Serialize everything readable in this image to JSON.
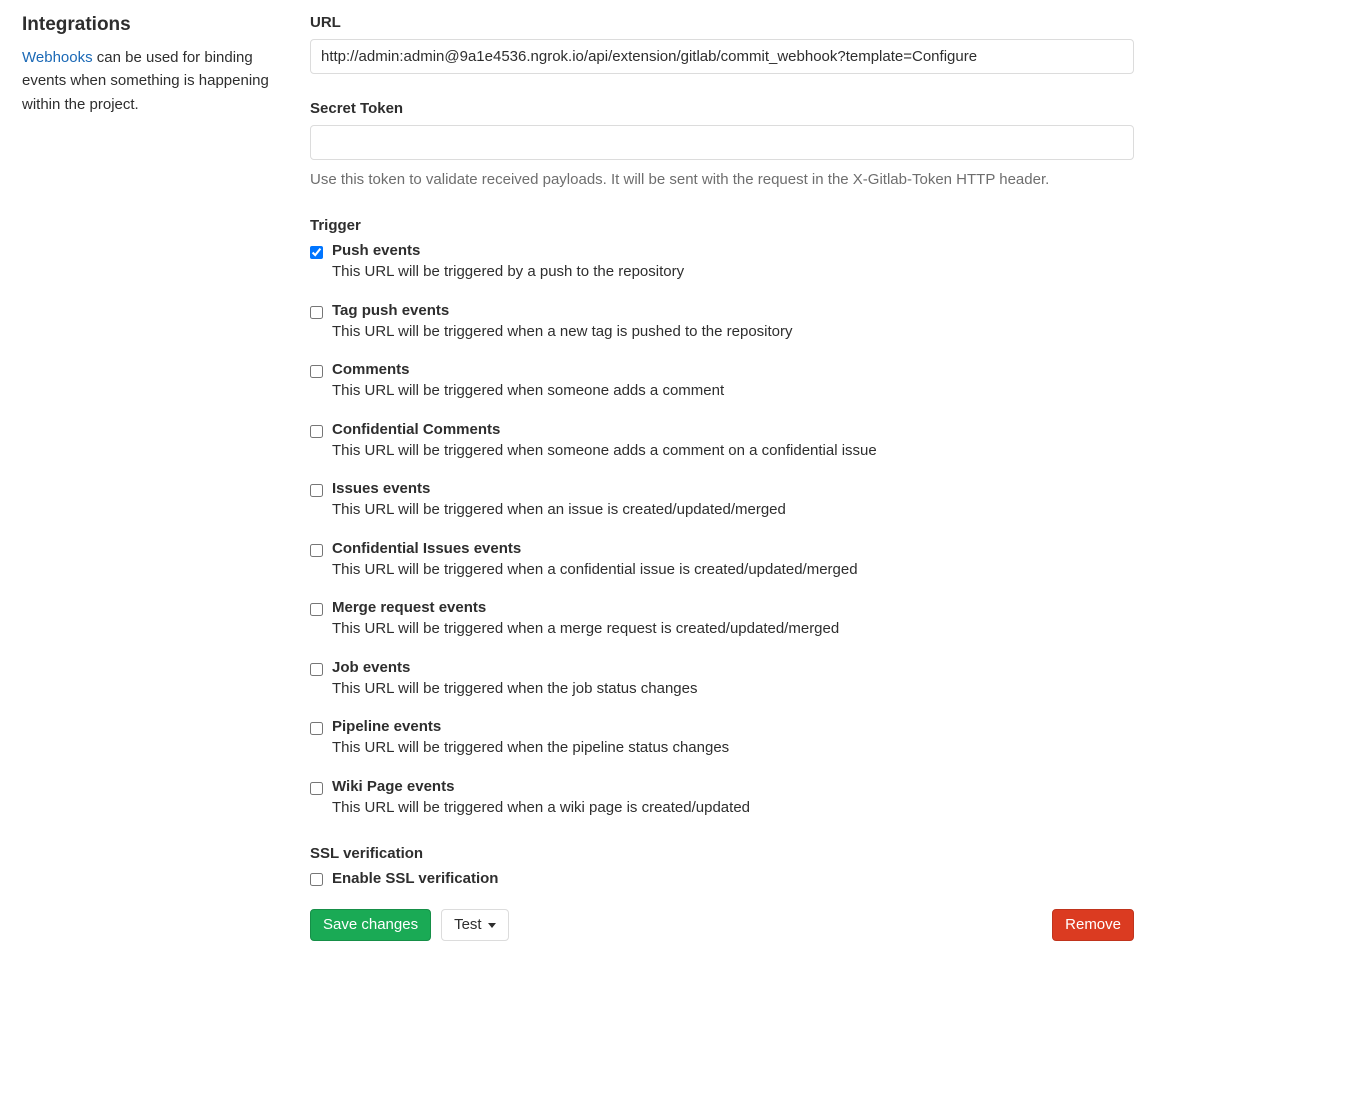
{
  "sidebar": {
    "heading": "Integrations",
    "link_text": "Webhooks",
    "desc_after_link": " can be used for binding events when something is happening within the project."
  },
  "url_field": {
    "label": "URL",
    "value": "http://admin:admin@9a1e4536.ngrok.io/api/extension/gitlab/commit_webhook?template=Configure"
  },
  "secret_field": {
    "label": "Secret Token",
    "value": "",
    "help": "Use this token to validate received payloads. It will be sent with the request in the X-Gitlab-Token HTTP header."
  },
  "trigger": {
    "heading": "Trigger",
    "items": [
      {
        "checked": true,
        "title": "Push events",
        "desc": "This URL will be triggered by a push to the repository"
      },
      {
        "checked": false,
        "title": "Tag push events",
        "desc": "This URL will be triggered when a new tag is pushed to the repository"
      },
      {
        "checked": false,
        "title": "Comments",
        "desc": "This URL will be triggered when someone adds a comment"
      },
      {
        "checked": false,
        "title": "Confidential Comments",
        "desc": "This URL will be triggered when someone adds a comment on a confidential issue"
      },
      {
        "checked": false,
        "title": "Issues events",
        "desc": "This URL will be triggered when an issue is created/updated/merged"
      },
      {
        "checked": false,
        "title": "Confidential Issues events",
        "desc": "This URL will be triggered when a confidential issue is created/updated/merged"
      },
      {
        "checked": false,
        "title": "Merge request events",
        "desc": "This URL will be triggered when a merge request is created/updated/merged"
      },
      {
        "checked": false,
        "title": "Job events",
        "desc": "This URL will be triggered when the job status changes"
      },
      {
        "checked": false,
        "title": "Pipeline events",
        "desc": "This URL will be triggered when the pipeline status changes"
      },
      {
        "checked": false,
        "title": "Wiki Page events",
        "desc": "This URL will be triggered when a wiki page is created/updated"
      }
    ]
  },
  "ssl": {
    "heading": "SSL verification",
    "label": "Enable SSL verification",
    "checked": false
  },
  "buttons": {
    "save": "Save changes",
    "test": "Test",
    "remove": "Remove"
  }
}
